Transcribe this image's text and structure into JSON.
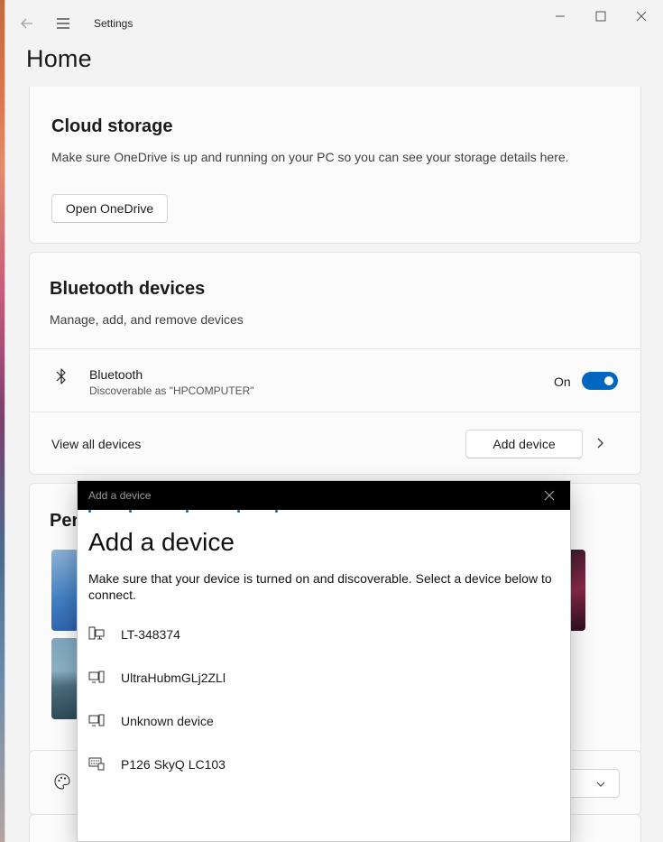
{
  "window": {
    "app_title": "Settings",
    "page_title": "Home"
  },
  "cloud_storage": {
    "title": "Cloud storage",
    "description": "Make sure OneDrive is up and running on your PC so you can see your storage details here.",
    "button_label": "Open OneDrive"
  },
  "bluetooth": {
    "title": "Bluetooth devices",
    "description": "Manage, add, and remove devices",
    "item_name": "Bluetooth",
    "item_sub": "Discoverable as \"HPCOMPUTER\"",
    "state_label": "On",
    "toggle_on": true,
    "view_all_label": "View all devices",
    "add_device_label": "Add device"
  },
  "personalization": {
    "title_visible": "Per"
  },
  "dialog": {
    "caption": "Add a device",
    "heading": "Add a device",
    "instructions": "Make sure that your device is turned on and discoverable. Select a device below to connect.",
    "devices": [
      {
        "name": "LT-348374",
        "icon": "computer-icon"
      },
      {
        "name": "UltraHubmGLj2ZLl",
        "icon": "device-icon"
      },
      {
        "name": "Unknown device",
        "icon": "device-icon"
      },
      {
        "name": "P126 SkyQ LC103",
        "icon": "keyboard-device-icon"
      }
    ]
  },
  "colors": {
    "accent": "#0067c0",
    "background": "#f3f3f3",
    "card": "#fbfbfb",
    "dialog_titlebar": "#000000"
  }
}
